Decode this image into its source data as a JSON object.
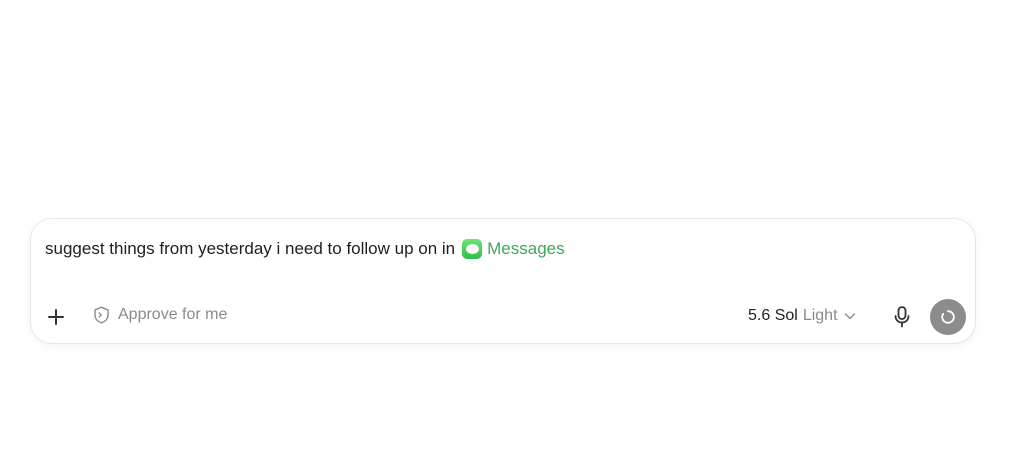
{
  "composer": {
    "prompt_text": "suggest things from yesterday i need to follow up on in",
    "app_mention": {
      "label": "Messages",
      "icon": "messages-app-icon",
      "color": "#3fa85a"
    },
    "toolbar": {
      "add_icon": "plus-icon",
      "approve_label": "Approve for me",
      "approve_icon": "shield-icon",
      "model_name": "5.6 Sol",
      "model_variant": "Light",
      "model_dropdown_icon": "chevron-down-icon",
      "mic_icon": "microphone-icon",
      "send_icon": "loading-spinner-icon",
      "send_button_color": "#8c8c8c"
    }
  }
}
